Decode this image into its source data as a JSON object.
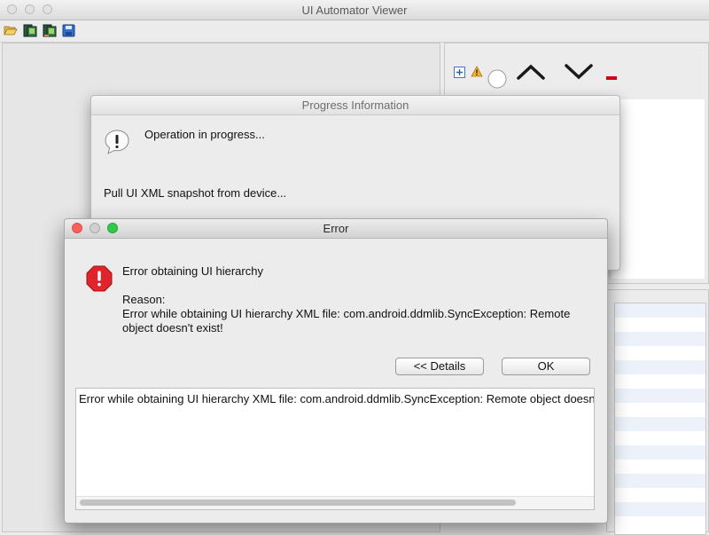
{
  "main_window": {
    "title": "UI Automator Viewer"
  },
  "toolbar": {
    "icons": [
      "folder-open-icon",
      "device-screenshot-icon",
      "device-screenshot-compressed-icon",
      "save-icon"
    ]
  },
  "right_toolbar": {
    "icons": [
      "expand-all-icon",
      "warning-icon",
      "circle-icon",
      "chevron-up-icon",
      "chevron-down-icon",
      "minus-icon"
    ]
  },
  "progress_dialog": {
    "title": "Progress Information",
    "message": "Operation in progress...",
    "task": "Pull UI XML snapshot from device...",
    "icon": "info-bubble-icon"
  },
  "error_dialog": {
    "title": "Error",
    "heading": "Error obtaining UI hierarchy",
    "reason_label": "Reason:",
    "reason_line1": "Error while obtaining UI hierarchy XML file: com.android.ddmlib.SyncException: Remote",
    "reason_line2": "object doesn't exist!",
    "details_button": "<< Details",
    "ok_button": "OK",
    "details_text": "Error while obtaining UI hierarchy XML file: com.android.ddmlib.SyncException: Remote object doesn't exist!",
    "icon": "error-stop-icon"
  },
  "colors": {
    "close": "#fc605b",
    "minimize": "#fdbc40",
    "zoom": "#34c84a",
    "error": "#e0242b"
  }
}
